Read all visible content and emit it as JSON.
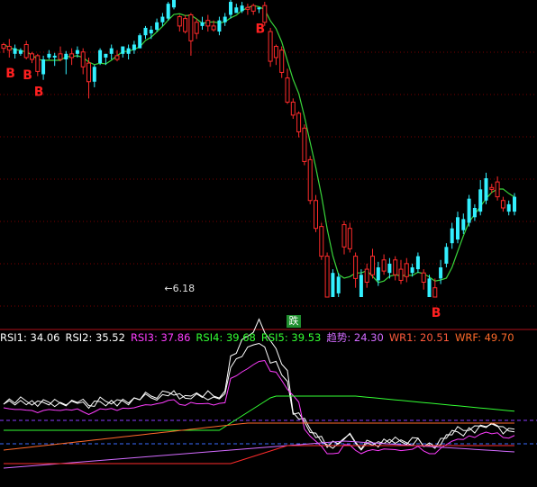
{
  "chart_data": [
    {
      "type": "candlestick",
      "description": "price panel with moving-average line and B markers",
      "y_grid": "dotted red horizontal gridlines",
      "candles": [
        {
          "i": 0,
          "o": 268,
          "c": 272,
          "h": 274,
          "l": 263,
          "up": true
        },
        {
          "i": 1,
          "o": 270,
          "c": 266,
          "h": 278,
          "l": 258,
          "up": true
        },
        {
          "i": 2,
          "o": 268,
          "c": 262,
          "h": 272,
          "l": 257,
          "up": false
        },
        {
          "i": 3,
          "o": 266,
          "c": 262,
          "h": 268,
          "l": 260,
          "up": false
        },
        {
          "i": 4,
          "o": 272,
          "c": 258,
          "h": 276,
          "l": 256,
          "up": true
        },
        {
          "i": 5,
          "o": 262,
          "c": 256,
          "h": 264,
          "l": 252,
          "up": true
        },
        {
          "i": 6,
          "o": 260,
          "c": 243,
          "h": 262,
          "l": 238,
          "up": true
        },
        {
          "i": 7,
          "o": 240,
          "c": 256,
          "h": 260,
          "l": 234,
          "up": false
        },
        {
          "i": 8,
          "o": 258,
          "c": 262,
          "h": 266,
          "l": 256,
          "up": false
        },
        {
          "i": 9,
          "o": 260,
          "c": 258,
          "h": 263,
          "l": 249,
          "up": false
        },
        {
          "i": 10,
          "o": 262,
          "c": 256,
          "h": 270,
          "l": 254,
          "up": true
        },
        {
          "i": 11,
          "o": 256,
          "c": 262,
          "h": 265,
          "l": 240,
          "up": false
        },
        {
          "i": 12,
          "o": 262,
          "c": 258,
          "h": 268,
          "l": 250,
          "up": true
        },
        {
          "i": 13,
          "o": 262,
          "c": 266,
          "h": 270,
          "l": 258,
          "up": false
        },
        {
          "i": 14,
          "o": 264,
          "c": 248,
          "h": 268,
          "l": 240,
          "up": true
        },
        {
          "i": 15,
          "o": 252,
          "c": 232,
          "h": 258,
          "l": 214,
          "up": true
        },
        {
          "i": 16,
          "o": 232,
          "c": 248,
          "h": 250,
          "l": 226,
          "up": false
        },
        {
          "i": 17,
          "o": 252,
          "c": 266,
          "h": 268,
          "l": 250,
          "up": false
        },
        {
          "i": 18,
          "o": 258,
          "c": 262,
          "h": 262,
          "l": 250,
          "up": false
        },
        {
          "i": 19,
          "o": 262,
          "c": 268,
          "h": 272,
          "l": 256,
          "up": false
        },
        {
          "i": 20,
          "o": 260,
          "c": 256,
          "h": 266,
          "l": 254,
          "up": true
        },
        {
          "i": 21,
          "o": 262,
          "c": 270,
          "h": 270,
          "l": 258,
          "up": false
        },
        {
          "i": 22,
          "o": 262,
          "c": 268,
          "h": 272,
          "l": 256,
          "up": false
        },
        {
          "i": 23,
          "o": 266,
          "c": 272,
          "h": 276,
          "l": 262,
          "up": false
        },
        {
          "i": 24,
          "o": 268,
          "c": 282,
          "h": 284,
          "l": 268,
          "up": false
        },
        {
          "i": 25,
          "o": 282,
          "c": 290,
          "h": 292,
          "l": 278,
          "up": false
        },
        {
          "i": 26,
          "o": 284,
          "c": 288,
          "h": 292,
          "l": 278,
          "up": false
        },
        {
          "i": 27,
          "o": 288,
          "c": 296,
          "h": 300,
          "l": 286,
          "up": false
        },
        {
          "i": 28,
          "o": 296,
          "c": 302,
          "h": 306,
          "l": 292,
          "up": false
        },
        {
          "i": 29,
          "o": 300,
          "c": 316,
          "h": 318,
          "l": 298,
          "up": false
        },
        {
          "i": 30,
          "o": 312,
          "c": 320,
          "h": 322,
          "l": 310,
          "up": false
        },
        {
          "i": 31,
          "o": 302,
          "c": 292,
          "h": 304,
          "l": 286,
          "up": true
        },
        {
          "i": 32,
          "o": 300,
          "c": 286,
          "h": 304,
          "l": 284,
          "up": true
        },
        {
          "i": 33,
          "o": 276,
          "c": 304,
          "h": 306,
          "l": 260,
          "up": true
        },
        {
          "i": 34,
          "o": 284,
          "c": 296,
          "h": 300,
          "l": 278,
          "up": true
        },
        {
          "i": 35,
          "o": 292,
          "c": 296,
          "h": 302,
          "l": 288,
          "up": false
        },
        {
          "i": 36,
          "o": 292,
          "c": 298,
          "h": 304,
          "l": 286,
          "up": true
        },
        {
          "i": 37,
          "o": 292,
          "c": 288,
          "h": 298,
          "l": 286,
          "up": true
        },
        {
          "i": 38,
          "o": 286,
          "c": 298,
          "h": 302,
          "l": 282,
          "up": false
        },
        {
          "i": 39,
          "o": 296,
          "c": 302,
          "h": 306,
          "l": 292,
          "up": false
        },
        {
          "i": 40,
          "o": 304,
          "c": 318,
          "h": 320,
          "l": 300,
          "up": false
        },
        {
          "i": 41,
          "o": 306,
          "c": 312,
          "h": 316,
          "l": 306,
          "up": false
        },
        {
          "i": 42,
          "o": 308,
          "c": 314,
          "h": 318,
          "l": 306,
          "up": false
        },
        {
          "i": 43,
          "o": 310,
          "c": 312,
          "h": 316,
          "l": 304,
          "up": true
        },
        {
          "i": 44,
          "o": 308,
          "c": 314,
          "h": 316,
          "l": 304,
          "up": true
        },
        {
          "i": 45,
          "o": 310,
          "c": 312,
          "h": 312,
          "l": 306,
          "up": false
        },
        {
          "i": 46,
          "o": 314,
          "c": 296,
          "h": 318,
          "l": 292,
          "up": true
        },
        {
          "i": 47,
          "o": 286,
          "c": 254,
          "h": 290,
          "l": 248,
          "up": true
        },
        {
          "i": 48,
          "o": 258,
          "c": 270,
          "h": 272,
          "l": 250,
          "up": true
        },
        {
          "i": 49,
          "o": 266,
          "c": 242,
          "h": 270,
          "l": 236,
          "up": true
        },
        {
          "i": 50,
          "o": 236,
          "c": 210,
          "h": 246,
          "l": 208,
          "up": true
        },
        {
          "i": 51,
          "o": 210,
          "c": 196,
          "h": 214,
          "l": 192,
          "up": true
        },
        {
          "i": 52,
          "o": 198,
          "c": 178,
          "h": 200,
          "l": 172,
          "up": true
        },
        {
          "i": 53,
          "o": 182,
          "c": 146,
          "h": 186,
          "l": 142,
          "up": true
        },
        {
          "i": 54,
          "o": 148,
          "c": 104,
          "h": 152,
          "l": 100,
          "up": true
        },
        {
          "i": 55,
          "o": 104,
          "c": 74,
          "h": 110,
          "l": 70,
          "up": true
        },
        {
          "i": 56,
          "o": 76,
          "c": 44,
          "h": 80,
          "l": 40,
          "up": true
        },
        {
          "i": 57,
          "o": 44,
          "c": 0,
          "h": 48,
          "l": 0,
          "up": true
        },
        {
          "i": 58,
          "o": 26,
          "c": 0,
          "h": 30,
          "l": 0,
          "up": false
        },
        {
          "i": 59,
          "o": 22,
          "c": 4,
          "h": 26,
          "l": 0,
          "up": false
        },
        {
          "i": 60,
          "o": 78,
          "c": 54,
          "h": 82,
          "l": 46,
          "up": true
        },
        {
          "i": 61,
          "o": 74,
          "c": 52,
          "h": 80,
          "l": 48,
          "up": true
        },
        {
          "i": 62,
          "o": 44,
          "c": 20,
          "h": 48,
          "l": 10,
          "up": true
        },
        {
          "i": 63,
          "o": 24,
          "c": 0,
          "h": 30,
          "l": 0,
          "up": false
        },
        {
          "i": 64,
          "o": 30,
          "c": 16,
          "h": 36,
          "l": 10,
          "up": true
        },
        {
          "i": 65,
          "o": 44,
          "c": 24,
          "h": 52,
          "l": 20,
          "up": true
        },
        {
          "i": 66,
          "o": 32,
          "c": 18,
          "h": 38,
          "l": 12,
          "up": false
        },
        {
          "i": 67,
          "o": 40,
          "c": 28,
          "h": 46,
          "l": 24,
          "up": true
        },
        {
          "i": 68,
          "o": 36,
          "c": 26,
          "h": 42,
          "l": 20,
          "up": false
        },
        {
          "i": 69,
          "o": 40,
          "c": 24,
          "h": 44,
          "l": 18,
          "up": true
        },
        {
          "i": 70,
          "o": 30,
          "c": 18,
          "h": 40,
          "l": 14,
          "up": true
        },
        {
          "i": 71,
          "o": 36,
          "c": 22,
          "h": 42,
          "l": 16,
          "up": true
        },
        {
          "i": 72,
          "o": 32,
          "c": 26,
          "h": 36,
          "l": 22,
          "up": false
        },
        {
          "i": 73,
          "o": 30,
          "c": 44,
          "h": 48,
          "l": 26,
          "up": false
        },
        {
          "i": 74,
          "o": 26,
          "c": 16,
          "h": 30,
          "l": 8,
          "up": true
        },
        {
          "i": 75,
          "o": 20,
          "c": 0,
          "h": 24,
          "l": 0,
          "up": false
        },
        {
          "i": 76,
          "o": 10,
          "c": 0,
          "h": 20,
          "l": 0,
          "up": true
        },
        {
          "i": 77,
          "o": 20,
          "c": 32,
          "h": 40,
          "l": 14,
          "up": false
        },
        {
          "i": 78,
          "o": 36,
          "c": 54,
          "h": 58,
          "l": 32,
          "up": false
        },
        {
          "i": 79,
          "o": 58,
          "c": 74,
          "h": 80,
          "l": 52,
          "up": false
        },
        {
          "i": 80,
          "o": 62,
          "c": 86,
          "h": 92,
          "l": 58,
          "up": false
        },
        {
          "i": 81,
          "o": 72,
          "c": 84,
          "h": 90,
          "l": 68,
          "up": false
        },
        {
          "i": 82,
          "o": 80,
          "c": 106,
          "h": 110,
          "l": 76,
          "up": false
        },
        {
          "i": 83,
          "o": 86,
          "c": 96,
          "h": 100,
          "l": 82,
          "up": false
        },
        {
          "i": 84,
          "o": 92,
          "c": 116,
          "h": 126,
          "l": 88,
          "up": false
        },
        {
          "i": 85,
          "o": 104,
          "c": 128,
          "h": 134,
          "l": 100,
          "up": false
        },
        {
          "i": 86,
          "o": 116,
          "c": 118,
          "h": 122,
          "l": 112,
          "up": true
        },
        {
          "i": 87,
          "o": 108,
          "c": 124,
          "h": 130,
          "l": 104,
          "up": true
        },
        {
          "i": 88,
          "o": 104,
          "c": 96,
          "h": 108,
          "l": 92,
          "up": true
        },
        {
          "i": 89,
          "o": 100,
          "c": 92,
          "h": 104,
          "l": 88,
          "up": false
        },
        {
          "i": 90,
          "o": 92,
          "c": 108,
          "h": 112,
          "l": 88,
          "up": false
        }
      ],
      "ma_line": "green moving-average line following price",
      "markers": [
        {
          "label": "B",
          "candle": 1
        },
        {
          "label": "B",
          "candle": 4
        },
        {
          "label": "B",
          "candle": 6
        },
        {
          "label": "B",
          "candle": 45
        },
        {
          "label": "B",
          "candle": 76
        }
      ],
      "annotation": "6.18"
    },
    {
      "type": "line",
      "description": "RSI / WR indicator panel",
      "legend": [
        {
          "name": "RSI1",
          "value": "34.06",
          "color": "#ffffff"
        },
        {
          "name": "RSI2",
          "value": "35.52",
          "color": "#ffffff"
        },
        {
          "name": "RSI3",
          "value": "37.86",
          "color": "#ff3dff"
        },
        {
          "name": "RSI4",
          "value": "39.68",
          "color": "#33ff33"
        },
        {
          "name": "RSI5",
          "value": "39.53",
          "color": "#33ff33"
        },
        {
          "name": "趋势",
          "value": "24.30",
          "color": "#d36bff"
        },
        {
          "name": "WR1",
          "value": "20.51",
          "color": "#ff5a3c"
        },
        {
          "name": "WRF",
          "value": "49.70",
          "color": "#ff6a2a"
        }
      ],
      "signal_badge": "跌",
      "reference_lines": [
        "dashed purple upper band",
        "dashed blue lower band"
      ]
    }
  ],
  "colors": {
    "background": "#000000",
    "up": "#ff2b2b",
    "down": "#33f0ff",
    "ma": "#39d53a",
    "grid": "#7a0000",
    "separator": "#b0101a",
    "marker": "#ff2020"
  }
}
